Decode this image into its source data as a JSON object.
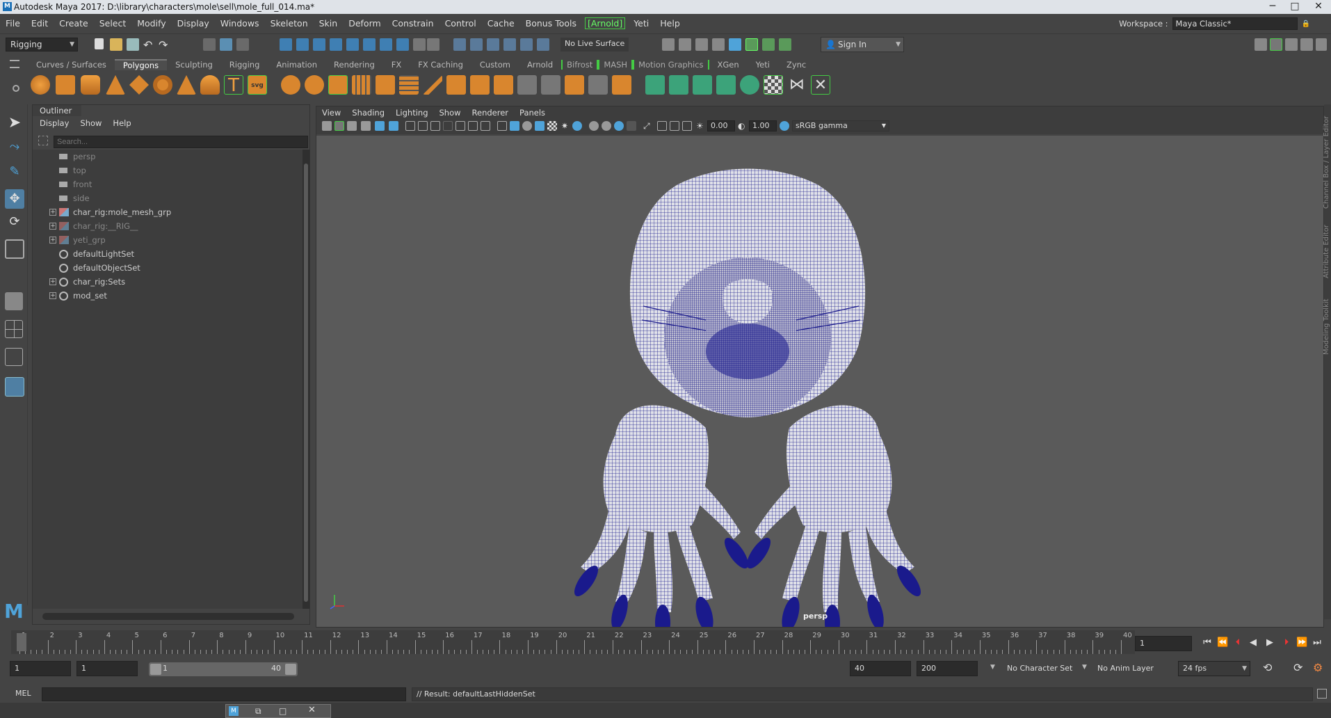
{
  "window": {
    "title": "Autodesk Maya 2017: D:\\library\\characters\\mole\\sell\\mole_full_014.ma*",
    "minimize": "─",
    "maximize": "□",
    "close": "✕"
  },
  "menubar": {
    "items": [
      "File",
      "Edit",
      "Create",
      "Select",
      "Modify",
      "Display",
      "Windows",
      "Skeleton",
      "Skin",
      "Deform",
      "Constrain",
      "Control",
      "Cache",
      "Bonus Tools",
      "[Arnold]",
      "Yeti",
      "Help"
    ],
    "workspace_label": "Workspace :",
    "workspace_value": "Maya Classic*"
  },
  "statusline": {
    "menuset": "Rigging",
    "live_surface": "No Live Surface",
    "sign_in": "Sign In"
  },
  "shelf": {
    "tabs": [
      "Curves / Surfaces",
      "Polygons",
      "Sculpting",
      "Rigging",
      "Animation",
      "Rendering",
      "FX",
      "FX Caching",
      "Custom",
      "Arnold",
      "Bifrost",
      "MASH",
      "Motion Graphics",
      "XGen",
      "Yeti",
      "Zync"
    ],
    "active_tab": "Polygons"
  },
  "outliner": {
    "title": "Outliner",
    "menu": [
      "Display",
      "Show",
      "Help"
    ],
    "search_placeholder": "Search...",
    "items": [
      {
        "label": "persp",
        "dim": true,
        "expand": false,
        "icon": "camera-icon"
      },
      {
        "label": "top",
        "dim": true,
        "expand": false,
        "icon": "camera-icon"
      },
      {
        "label": "front",
        "dim": true,
        "expand": false,
        "icon": "camera-icon"
      },
      {
        "label": "side",
        "dim": true,
        "expand": false,
        "icon": "camera-icon"
      },
      {
        "label": "char_rig:mole_mesh_grp",
        "dim": false,
        "expand": true,
        "icon": "group-icon"
      },
      {
        "label": "char_rig:__RIG__",
        "dim": true,
        "expand": true,
        "icon": "group-icon"
      },
      {
        "label": "yeti_grp",
        "dim": true,
        "expand": true,
        "icon": "group-icon"
      },
      {
        "label": "defaultLightSet",
        "dim": false,
        "expand": false,
        "icon": "set-icon"
      },
      {
        "label": "defaultObjectSet",
        "dim": false,
        "expand": false,
        "icon": "set-icon"
      },
      {
        "label": "char_rig:Sets",
        "dim": false,
        "expand": true,
        "icon": "set-icon"
      },
      {
        "label": "mod_set",
        "dim": false,
        "expand": true,
        "icon": "set-icon"
      }
    ]
  },
  "viewport": {
    "menu": [
      "View",
      "Shading",
      "Lighting",
      "Show",
      "Renderer",
      "Panels"
    ],
    "exposure": "0.00",
    "gamma": "1.00",
    "color_space": "sRGB gamma",
    "camera": "persp"
  },
  "side_tabs": [
    "Channel Box / Layer Editor",
    "Attribute Editor",
    "Modeling Toolkit"
  ],
  "timeline": {
    "ticks": [
      1,
      2,
      3,
      4,
      5,
      6,
      7,
      8,
      9,
      10,
      11,
      12,
      13,
      14,
      15,
      16,
      17,
      18,
      19,
      20,
      21,
      22,
      23,
      24,
      25,
      26,
      27,
      28,
      29,
      30,
      31,
      32,
      33,
      34,
      35,
      36,
      37,
      38,
      39,
      40
    ],
    "current_frame": "1"
  },
  "range": {
    "start": "1",
    "start2": "1",
    "slider_start": "1",
    "slider_end": "40",
    "end": "40",
    "end2": "200",
    "character_set": "No Character Set",
    "anim_layer": "No Anim Layer",
    "fps": "24 fps"
  },
  "commandline": {
    "lang": "MEL",
    "result": "// Result: defaultLastHiddenSet"
  },
  "colors": {
    "wire": "#1a1a8c",
    "viewport_bg": "#5a5a5a",
    "accent": "#4fa3d9"
  }
}
